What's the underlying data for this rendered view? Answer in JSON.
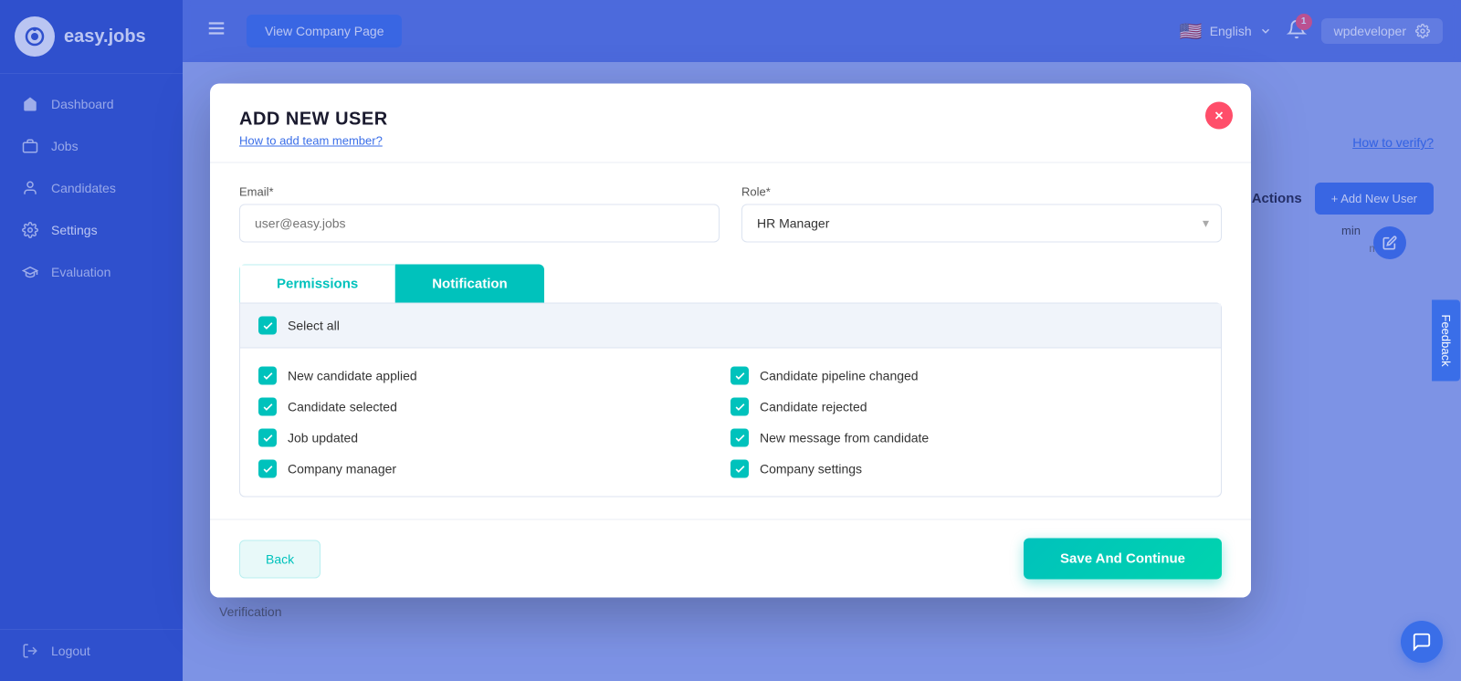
{
  "app": {
    "name": "easy.jobs",
    "logo_letter": "q"
  },
  "sidebar": {
    "items": [
      {
        "id": "dashboard",
        "label": "Dashboard",
        "icon": "home"
      },
      {
        "id": "jobs",
        "label": "Jobs",
        "icon": "briefcase"
      },
      {
        "id": "candidates",
        "label": "Candidates",
        "icon": "user"
      },
      {
        "id": "settings",
        "label": "Settings",
        "icon": "gear"
      },
      {
        "id": "evaluation",
        "label": "Evaluation",
        "icon": "graduation"
      }
    ],
    "logout_label": "Logout"
  },
  "header": {
    "menu_icon": "menu",
    "view_company_btn": "View Company Page",
    "language": "English",
    "notification_count": "1",
    "username": "wpdeveloper",
    "how_verify_link": "How to verify?"
  },
  "main": {
    "add_user_btn": "+ Add New User",
    "actions_label": "Actions",
    "feedback_label": "Feedback",
    "verification_label": "Verification"
  },
  "modal": {
    "title": "ADD NEW USER",
    "subtitle": "How to add team member?",
    "email_label": "Email*",
    "email_placeholder": "user@easy.jobs",
    "role_label": "Role*",
    "role_value": "HR Manager",
    "tabs": [
      {
        "id": "permissions",
        "label": "Permissions",
        "active": false
      },
      {
        "id": "notification",
        "label": "Notification",
        "active": true
      }
    ],
    "select_all_label": "Select all",
    "notifications": [
      {
        "label": "New candidate applied",
        "checked": true
      },
      {
        "label": "Candidate pipeline changed",
        "checked": true
      },
      {
        "label": "Candidate selected",
        "checked": true
      },
      {
        "label": "Candidate rejected",
        "checked": true
      },
      {
        "label": "Job updated",
        "checked": true
      },
      {
        "label": "New message from candidate",
        "checked": true
      },
      {
        "label": "Company manager",
        "checked": true
      },
      {
        "label": "Company settings",
        "checked": true
      }
    ],
    "back_btn": "Back",
    "save_btn": "Save And Continue"
  }
}
